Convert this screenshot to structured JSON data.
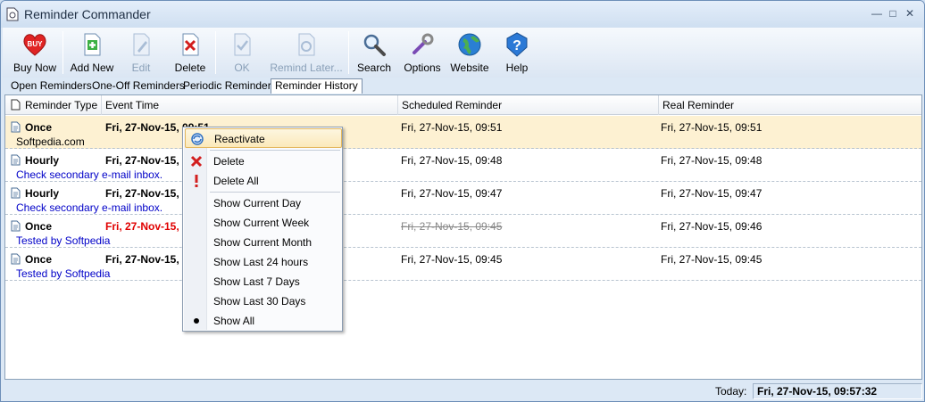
{
  "window": {
    "title": "Reminder Commander"
  },
  "toolbar": {
    "buttons": [
      {
        "label": "Buy Now",
        "icon": "buy-now-heart-icon"
      },
      {
        "label": "Add New",
        "icon": "add-new-doc-icon"
      },
      {
        "label": "Edit",
        "icon": "edit-doc-icon"
      },
      {
        "label": "Delete",
        "icon": "delete-doc-icon"
      },
      {
        "label": "OK",
        "icon": "ok-doc-icon"
      },
      {
        "label": "Remind Later...",
        "icon": "remind-later-doc-icon"
      },
      {
        "label": "Search",
        "icon": "magnifier-icon"
      },
      {
        "label": "Options",
        "icon": "wrench-icon"
      },
      {
        "label": "Website",
        "icon": "globe-icon"
      },
      {
        "label": "Help",
        "icon": "help-icon"
      }
    ]
  },
  "tabs": [
    {
      "label": "Open Reminders"
    },
    {
      "label": "One-Off Reminders"
    },
    {
      "label": "Periodic Reminders"
    },
    {
      "label": "Reminder History"
    }
  ],
  "list": {
    "columns": [
      "Reminder Type",
      "Event Time",
      "Scheduled Reminder",
      "Real Reminder"
    ],
    "rows": [
      {
        "type": "Once",
        "event_time": "Fri, 27-Nov-15, 09:51",
        "scheduled": "Fri, 27-Nov-15, 09:51",
        "real": "Fri, 27-Nov-15, 09:51",
        "desc": "Softpedia.com"
      },
      {
        "type": "Hourly",
        "event_time": "Fri, 27-Nov-15, 09:48",
        "scheduled": "Fri, 27-Nov-15, 09:48",
        "real": "Fri, 27-Nov-15, 09:48",
        "desc": "Check secondary e-mail inbox."
      },
      {
        "type": "Hourly",
        "event_time": "Fri, 27-Nov-15, 09:47",
        "scheduled": "Fri, 27-Nov-15, 09:47",
        "real": "Fri, 27-Nov-15, 09:47",
        "desc": "Check secondary e-mail inbox."
      },
      {
        "type": "Once",
        "event_time": "Fri, 27-Nov-15, 09:45",
        "scheduled": "Fri, 27-Nov-15, 09:45",
        "real": "Fri, 27-Nov-15, 09:46",
        "desc": "Tested by Softpedia"
      },
      {
        "type": "Once",
        "event_time": "Fri, 27-Nov-15, 09:45",
        "scheduled": "Fri, 27-Nov-15, 09:45",
        "real": "Fri, 27-Nov-15, 09:45",
        "desc": "Tested by Softpedia"
      }
    ]
  },
  "context_menu": {
    "items": [
      {
        "label": "Reactivate",
        "icon": "reactivate-icon"
      },
      {
        "label": "Delete",
        "icon": "red-x-icon"
      },
      {
        "label": "Delete All",
        "icon": "exclamation-icon"
      },
      {
        "label": "Show Current Day"
      },
      {
        "label": "Show Current Week"
      },
      {
        "label": "Show Current Month"
      },
      {
        "label": "Show Last 24 hours"
      },
      {
        "label": "Show Last 7 Days"
      },
      {
        "label": "Show Last 30 Days"
      },
      {
        "label": "Show All",
        "icon": "radio-bullet-icon"
      }
    ]
  },
  "status": {
    "today_label": "Today:",
    "today_value": "Fri, 27-Nov-15, 09:57:32"
  },
  "colors": {
    "accent": "#dce8f5",
    "selected_row": "#fdf1d2",
    "desc_link": "#0000c8",
    "red_time": "#e00000"
  }
}
